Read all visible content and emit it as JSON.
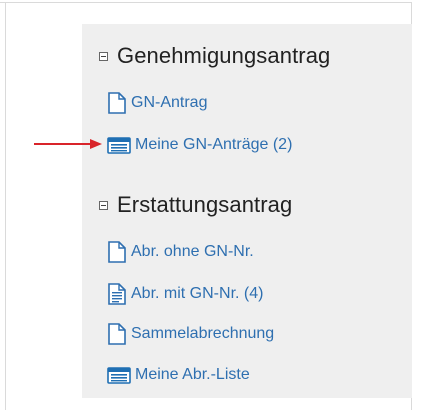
{
  "sections": [
    {
      "title": "Genehmigungsantrag",
      "items": [
        {
          "label": "GN-Antrag",
          "icon": "document-icon"
        },
        {
          "label": "Meine GN-Anträge (2)",
          "icon": "list-window-icon"
        }
      ]
    },
    {
      "title": "Erstattungsantrag",
      "items": [
        {
          "label": "Abr. ohne GN-Nr.",
          "icon": "document-icon"
        },
        {
          "label": "Abr. mit GN-Nr. (4)",
          "icon": "document-lines-icon"
        },
        {
          "label": "Sammelabrechnung",
          "icon": "document-icon"
        },
        {
          "label": "Meine Abr.-Liste",
          "icon": "list-window-icon"
        }
      ]
    }
  ],
  "colors": {
    "link": "#2e6fb0",
    "heading": "#222222",
    "panel_bg": "#efefef",
    "arrow": "#d9242a"
  }
}
